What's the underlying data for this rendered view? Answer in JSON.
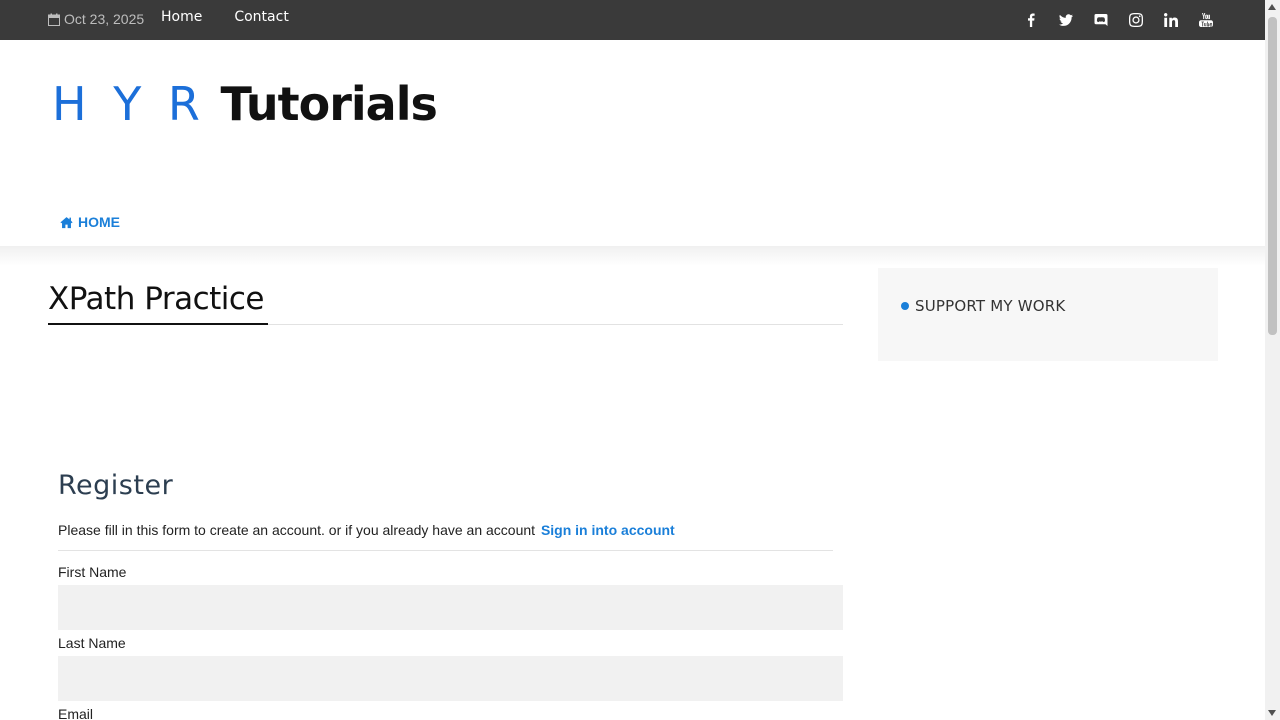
{
  "topbar": {
    "date": "Oct 23, 2025",
    "nav": [
      {
        "label": "Home"
      },
      {
        "label": "Contact"
      }
    ],
    "social_icons": [
      "facebook-icon",
      "twitter-icon",
      "discord-icon",
      "instagram-icon",
      "linkedin-icon",
      "youtube-icon"
    ]
  },
  "header": {
    "logo_part1": "H Y R",
    "logo_part2": "Tutorials",
    "nav_home": "HOME"
  },
  "main": {
    "page_title": "XPath Practice",
    "register": {
      "heading": "Register",
      "intro": "Please fill in this form to create an account. or if you already have an account",
      "signin_link": "Sign in into account",
      "fields": [
        {
          "label": "First Name",
          "value": ""
        },
        {
          "label": "Last Name",
          "value": ""
        },
        {
          "label": "Email",
          "value": ""
        }
      ]
    }
  },
  "sidebar": {
    "title": "SUPPORT MY WORK"
  },
  "colors": {
    "accent": "#1a7fd9",
    "topbar_bg": "#3a3a3a",
    "input_bg": "#f1f1f1"
  }
}
